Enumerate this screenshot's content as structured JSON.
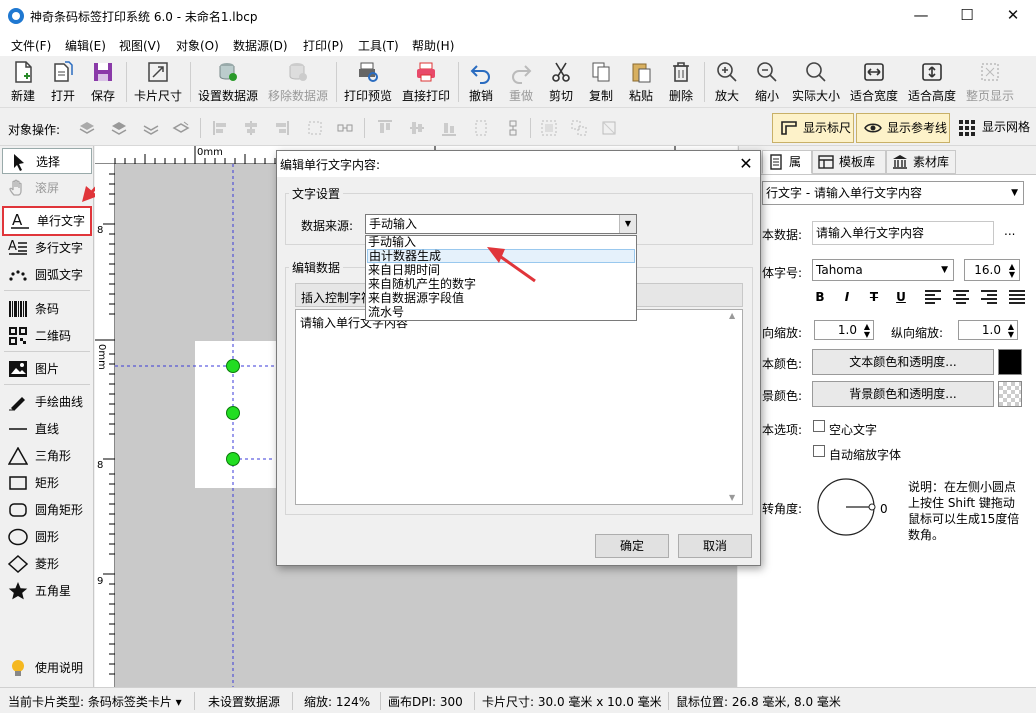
{
  "window": {
    "title": "神奇条码标签打印系统 6.0 - 未命名1.lbcp",
    "minimize": "—",
    "maximize": "☐",
    "close": "✕"
  },
  "menu": [
    "文件(F)",
    "编辑(E)",
    "视图(V)",
    "对象(O)",
    "数据源(D)",
    "打印(P)",
    "工具(T)",
    "帮助(H)"
  ],
  "toolbar": {
    "new": "新建",
    "open": "打开",
    "save": "保存",
    "card_size": "卡片尺寸",
    "set_datasource": "设置数据源",
    "remove_datasource": "移除数据源",
    "print_preview": "打印预览",
    "direct_print": "直接打印",
    "undo": "撤销",
    "redo": "重做",
    "cut": "剪切",
    "copy": "复制",
    "paste": "粘贴",
    "delete": "删除",
    "zoom_in": "放大",
    "zoom_out": "缩小",
    "actual_size": "实际大小",
    "fit_width": "适合宽度",
    "fit_height": "适合高度",
    "full_page": "整页显示"
  },
  "opsbar": {
    "label": "对象操作:",
    "show_ruler": "显示标尺",
    "show_guides": "显示参考线",
    "show_grid": "显示网格"
  },
  "palette": {
    "select": "选择",
    "scroll": "滚屏",
    "single_text": "单行文字",
    "multi_text": "多行文字",
    "arc_text": "圆弧文字",
    "barcode": "条码",
    "qrcode": "二维码",
    "image": "图片",
    "freehand": "手绘曲线",
    "line": "直线",
    "triangle": "三角形",
    "rectangle": "矩形",
    "rounded_rect": "圆角矩形",
    "circle": "圆形",
    "diamond": "菱形",
    "star": "五角星",
    "help": "使用说明"
  },
  "ruler": {
    "top_label": "0mm",
    "left_label": "0mm",
    "left_ticks": [
      "8",
      "8",
      "9"
    ]
  },
  "right_panel": {
    "tabs": [
      "属性栏",
      "模板库",
      "素材库"
    ],
    "object_selector": "行文字 - 请输入单行文字内容",
    "text_data_label": "本数据:",
    "text_data_value": "请输入单行文字内容",
    "more": "...",
    "font_label": "体字号:",
    "font_name": "Tahoma",
    "font_size": "16.0",
    "format": [
      "B",
      "I",
      "T",
      "U"
    ],
    "hscale_label": "向缩放:",
    "hscale_value": "1.0",
    "vscale_label": "纵向缩放:",
    "vscale_value": "1.0",
    "text_color_label": "本颜色:",
    "text_color_btn": "文本颜色和透明度...",
    "bg_color_label": "景颜色:",
    "bg_color_btn": "背景颜色和透明度...",
    "text_options_label": "本选项:",
    "hollow_text": "空心文字",
    "auto_shrink": "自动缩放字体",
    "rotate_label": "转角度:",
    "rotate_value": "0",
    "rotate_note": "说明：在左侧小圆点上按住 Shift 键拖动鼠标可以生成15度倍数角。"
  },
  "dialog": {
    "title": "编辑单行文字内容:",
    "close": "✕",
    "text_settings": "文字设置",
    "datasource_label": "数据来源:",
    "datasource_value": "手动输入",
    "options": [
      "手动输入",
      "由计数器生成",
      "来自日期时间",
      "来自随机产生的数字",
      "来自数据源字段值",
      "流水号"
    ],
    "edit_data": "编辑数据",
    "insert_ctrl": "插入控制字符",
    "content": "请输入单行文字内容",
    "ok": "确定",
    "cancel": "取消"
  },
  "status": {
    "card_type": "当前卡片类型: 条码标签类卡片 ▾",
    "datasource": "未设置数据源",
    "zoom": "缩放: 124%",
    "dpi": "画布DPI: 300",
    "card_size": "卡片尺寸: 30.0 毫米 x 10.0 毫米",
    "mouse_pos": "鼠标位置: 26.8 毫米, 8.0 毫米"
  },
  "colors": {
    "accent_red": "#e0353a",
    "handle_green": "#22dd22",
    "guide_blue": "#3a3ad8",
    "toggle_bg": "#fdf2c9"
  }
}
